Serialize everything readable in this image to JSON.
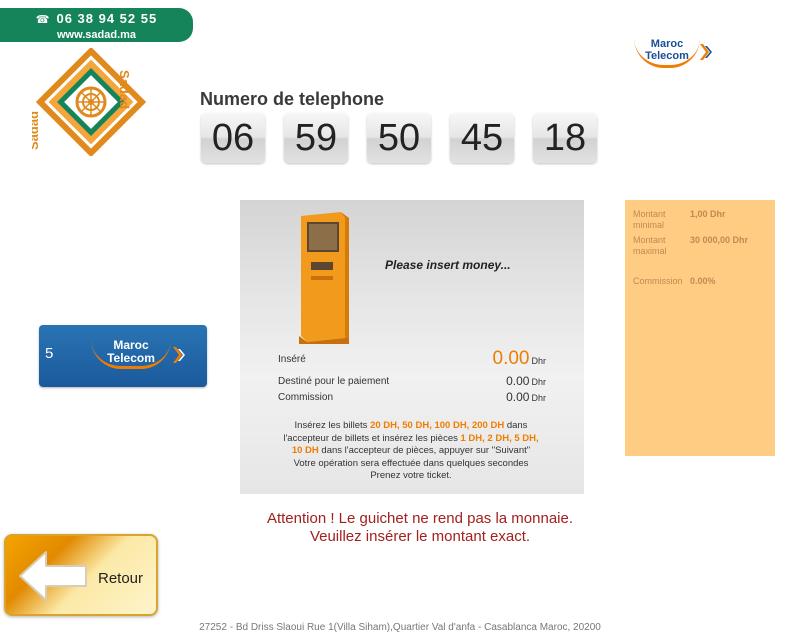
{
  "header": {
    "phone": "06 38 94 52 55",
    "website": "www.sadad.ma"
  },
  "brand": {
    "operator_line1": "Maroc",
    "operator_line2": "Telecom",
    "sadad_name": "Sadad"
  },
  "phone_number": {
    "label": "Numero de telephone",
    "digits": [
      "06",
      "59",
      "50",
      "45",
      "18"
    ]
  },
  "operator_card": {
    "amount": "5"
  },
  "payment": {
    "prompt": "Please insert money...",
    "inserted_label": "Inséré",
    "inserted_value": "0.00",
    "destined_label": "Destiné pour le paiement",
    "destined_value": "0.00",
    "commission_label": "Commission",
    "commission_value": "0.00",
    "currency": "Dhr",
    "instructions": {
      "t1": "Insérez les billets ",
      "notes": "20 DH, 50 DH, 100 DH, 200 DH",
      "t2": " dans l'accepteur de billets et insérez les pièces ",
      "coins": "1 DH, 2 DH, 5 DH, 10 DH",
      "t3": " dans l'accepteur de pièces, appuyer sur \"Suivant\"  Votre opération sera effectuée dans quelques secondes  Prenez votre ticket."
    }
  },
  "limits": {
    "min_label": "Montant minimal",
    "min_value": "1,00 Dhr",
    "max_label": "Montant maximal",
    "max_value": "30 000,00 Dhr",
    "commission_label": "Commission",
    "commission_value": "0.00%"
  },
  "notice": {
    "line1": "Attention ! Le guichet ne rend pas la monnaie.",
    "line2": "Veuillez insérer le montant exact."
  },
  "back_button": {
    "label": "Retour"
  },
  "footer": {
    "address": "27252 - Bd Driss Slaoui Rue 1(Villa Siham),Quartier Val d'anfa - Casablanca Maroc, 20200"
  },
  "colors": {
    "green_banner": "#15845a",
    "orange_accent": "#f07d00",
    "operator_blue": "#1a5a9c",
    "info_panel": "#ffcc84",
    "notice_red": "#a3201e"
  }
}
